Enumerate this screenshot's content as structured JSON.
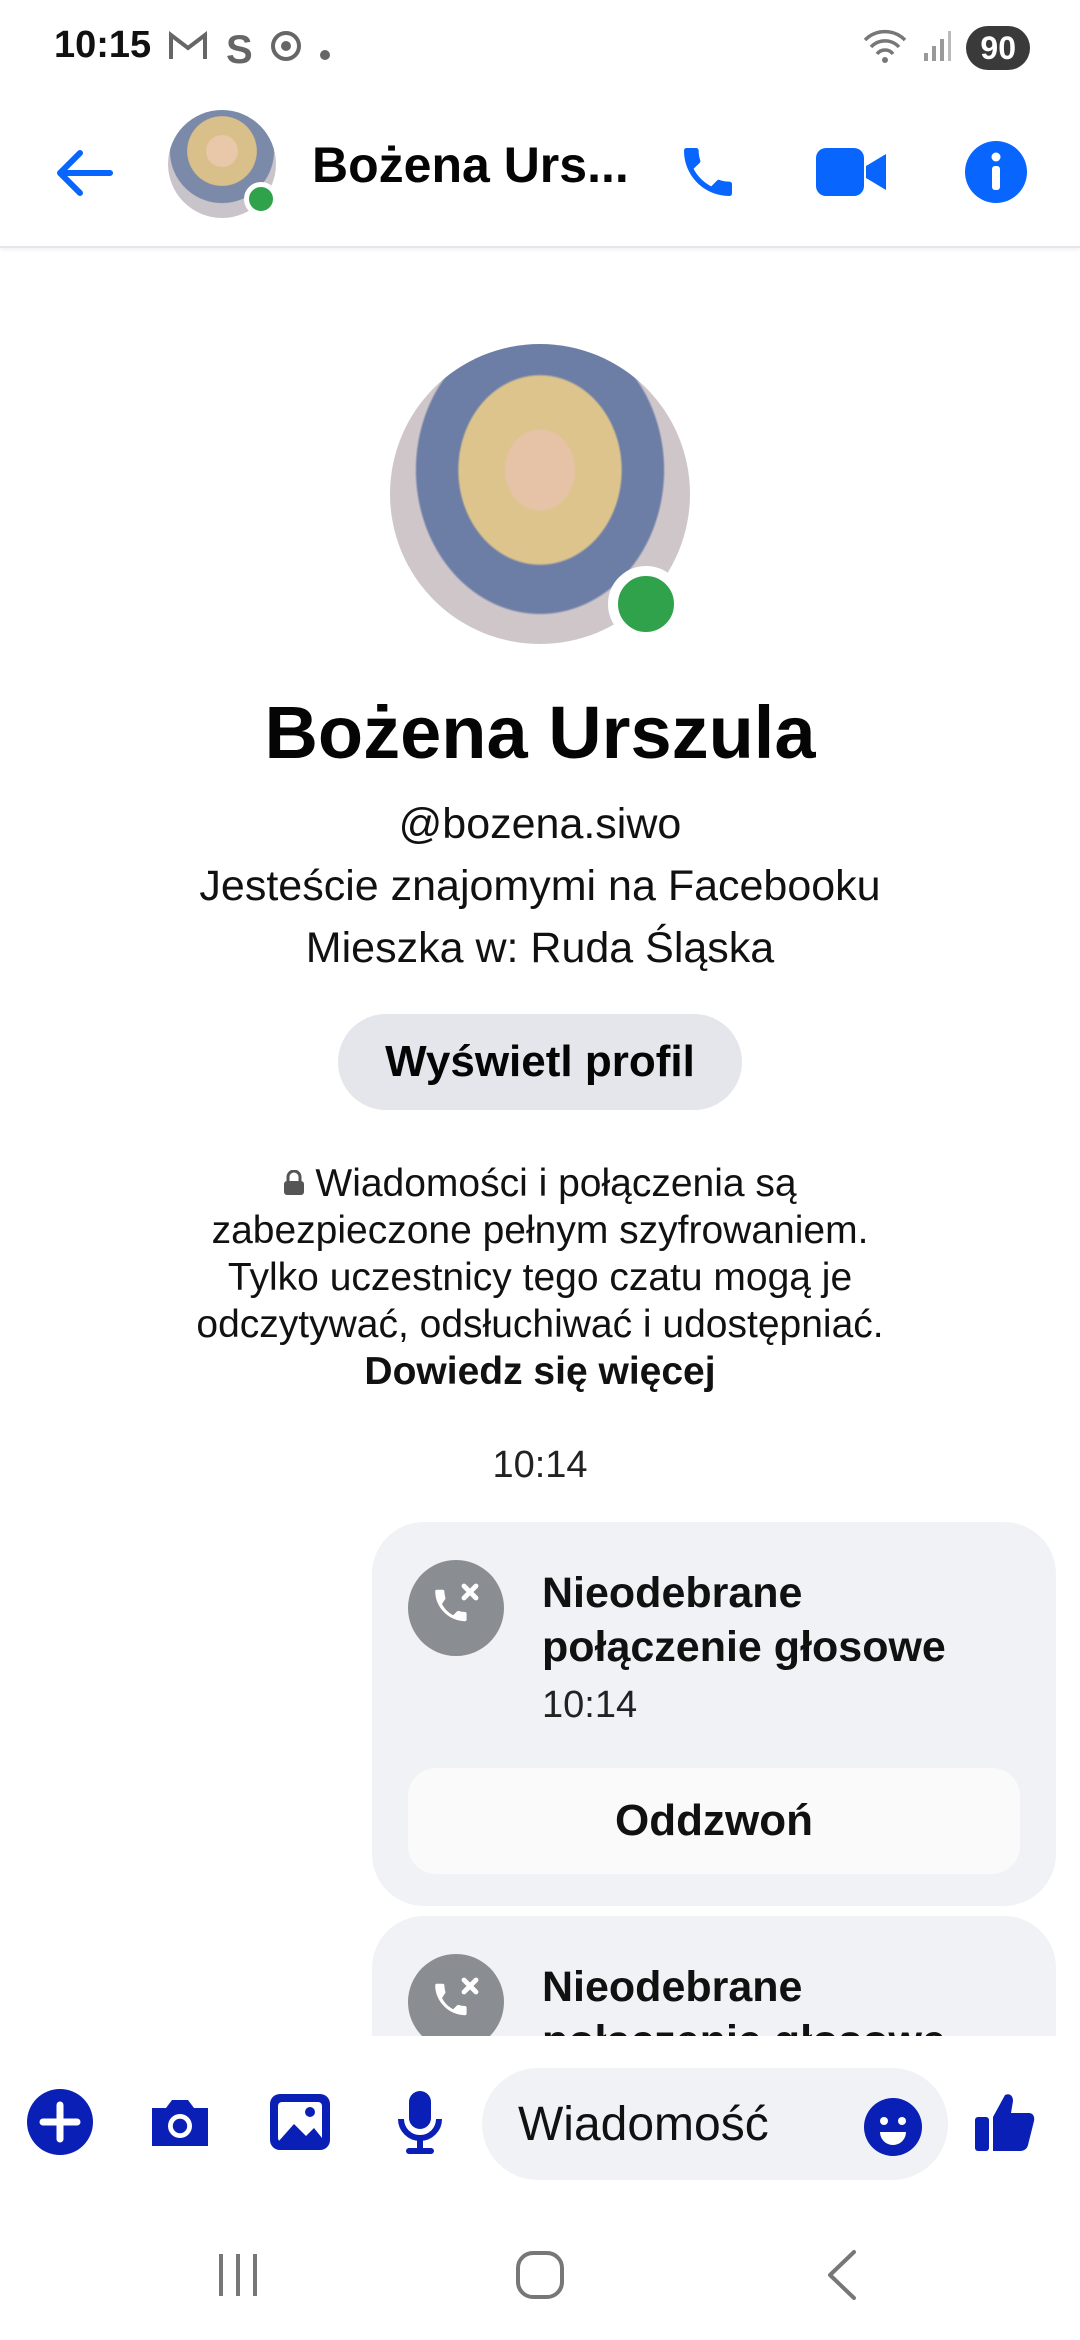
{
  "status_bar": {
    "time": "10:15",
    "left_icons": [
      "gmail-icon",
      "s-app-icon",
      "chrome-icon",
      "dot-icon"
    ],
    "battery": "90"
  },
  "header": {
    "contact_name": "Bożena Urs...",
    "back_icon": "arrow-left-icon",
    "voice_call_icon": "phone-icon",
    "video_call_icon": "video-camera-icon",
    "info_icon": "info-icon",
    "accent_color": "#0866ff",
    "online_color": "#31a24c"
  },
  "profile": {
    "name": "Bożena Urszula",
    "username": "@bozena.siwo",
    "relationship": "Jesteście znajomymi na Facebooku",
    "location": "Mieszka w: Ruda Śląska",
    "view_profile_label": "Wyświetl profil"
  },
  "encryption_note": {
    "text": "Wiadomości i połączenia są zabezpieczone pełnym szyfrowaniem. Tylko uczestnicy tego czatu mogą je odczytywać, odsłuchiwać i udostępniać.",
    "link": "Dowiedz się więcej"
  },
  "conversation": {
    "timestamp": "10:14",
    "messages": [
      {
        "title": "Nieodebrane połączenie głosowe",
        "time": "10:14",
        "action": "Oddzwoń"
      },
      {
        "title": "Nieodebrane połączenie głosowe"
      }
    ]
  },
  "composer": {
    "placeholder": "Wiadomość",
    "icons": [
      "plus-icon",
      "camera-icon",
      "gallery-icon",
      "microphone-icon",
      "emoji-icon",
      "thumbs-up-icon"
    ]
  },
  "navbar": {
    "icons": [
      "recents-icon",
      "home-icon",
      "back-icon"
    ]
  }
}
